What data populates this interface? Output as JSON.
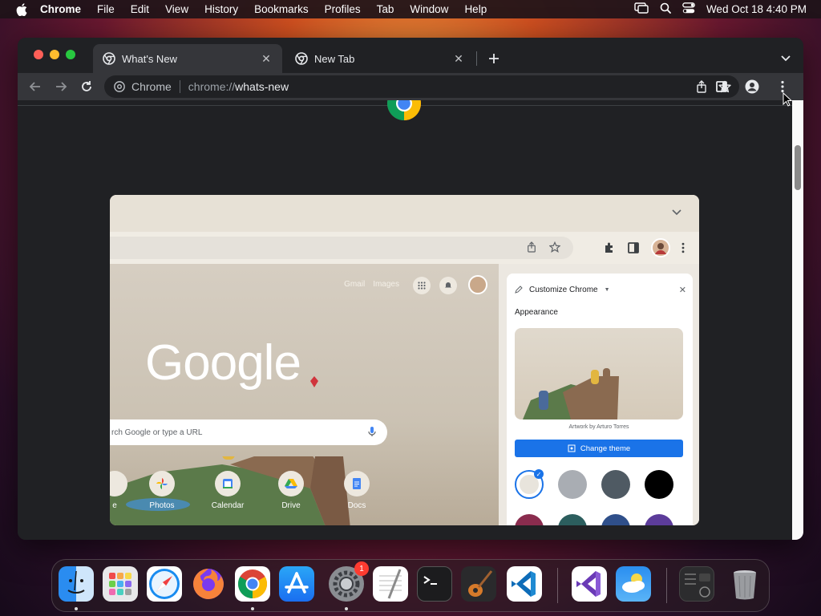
{
  "menubar": {
    "items": [
      "Chrome",
      "File",
      "Edit",
      "View",
      "History",
      "Bookmarks",
      "Profiles",
      "Tab",
      "Window",
      "Help"
    ],
    "clock": "Wed Oct 18  4:40 PM"
  },
  "tabs": [
    {
      "title": "What's New",
      "active": true
    },
    {
      "title": "New Tab",
      "active": false
    }
  ],
  "omnibox": {
    "chip_label": "Chrome",
    "url_scheme": "chrome://",
    "url_host": "whats-new"
  },
  "promo": {
    "panel_title": "Customize Chrome",
    "appearance_label": "Appearance",
    "artwork_credit": "Artwork by Arturo Torres",
    "change_theme_label": "Change theme",
    "top_links": [
      "Gmail",
      "Images"
    ],
    "google_logo_text": "Google",
    "search_placeholder": "rch Google or type a URL",
    "shortcuts": [
      {
        "label": "e"
      },
      {
        "label": "Photos"
      },
      {
        "label": "Calendar"
      },
      {
        "label": "Drive"
      },
      {
        "label": "Docs"
      }
    ],
    "swatch_colors": [
      "#e8e4dc",
      "#a9adb3",
      "#4f5a63",
      "#000000"
    ],
    "swatch_colors_row2": [
      "#8a2c4e",
      "#2c5e5e",
      "#2f4f8a",
      "#5c3c9a"
    ]
  },
  "dock": {
    "apps": [
      {
        "name": "Finder",
        "icon": "finder-icon",
        "running": true
      },
      {
        "name": "Launchpad",
        "icon": "launchpad-icon",
        "running": false
      },
      {
        "name": "Safari",
        "icon": "safari-icon",
        "running": false
      },
      {
        "name": "Firefox",
        "icon": "firefox-icon",
        "running": false
      },
      {
        "name": "Chrome",
        "icon": "chrome-icon",
        "running": true
      },
      {
        "name": "App Store",
        "icon": "app-store-icon",
        "running": false
      },
      {
        "name": "System Settings",
        "icon": "system-settings-icon",
        "running": true,
        "badge": "1"
      },
      {
        "name": "TextEdit",
        "icon": "textedit-icon",
        "running": false
      },
      {
        "name": "Terminal",
        "icon": "terminal-icon",
        "running": false
      },
      {
        "name": "GarageBand",
        "icon": "garageband-icon",
        "running": false
      },
      {
        "name": "VS Code",
        "icon": "vscode-icon",
        "running": false
      },
      {
        "name": "Visual Studio",
        "icon": "visual-studio-icon",
        "running": false
      },
      {
        "name": "Weather",
        "icon": "weather-icon",
        "running": false
      },
      {
        "name": "Downloads",
        "icon": "downloads-stack-icon",
        "running": false
      },
      {
        "name": "Trash",
        "icon": "trash-icon",
        "running": false
      }
    ]
  }
}
